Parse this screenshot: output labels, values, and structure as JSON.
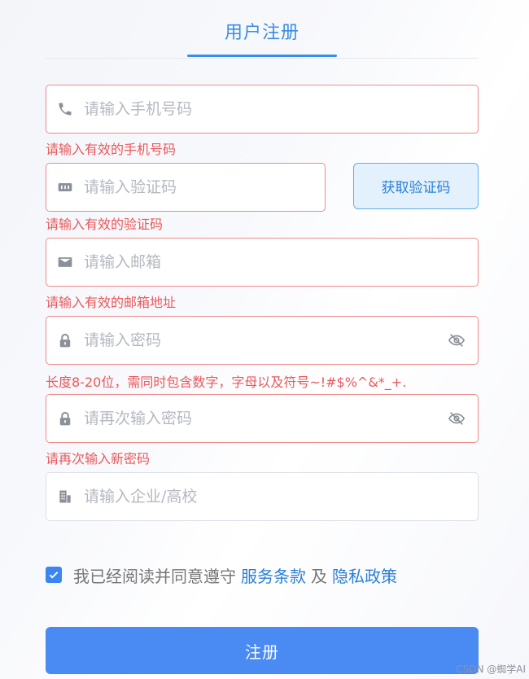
{
  "header": {
    "title": "用户注册"
  },
  "form": {
    "phone": {
      "placeholder": "请输入手机号码",
      "error": "请输入有效的手机号码"
    },
    "code": {
      "placeholder": "请输入验证码",
      "error": "请输入有效的验证码",
      "button_label": "获取验证码"
    },
    "email": {
      "placeholder": "请输入邮箱",
      "error": "请输入有效的邮箱地址"
    },
    "password": {
      "placeholder": "请输入密码",
      "error": "长度8-20位，需同时包含数字，字母以及符号~!#$%^&*_+."
    },
    "confirm": {
      "placeholder": "请再次输入密码",
      "error": "请再次输入新密码"
    },
    "company": {
      "placeholder": "请输入企业/高校"
    }
  },
  "agreement": {
    "checked": true,
    "prefix": "我已经阅读并同意遵守",
    "terms_link": "服务条款",
    "and": "及",
    "privacy_link": "隐私政策"
  },
  "submit_label": "注册",
  "watermark": "CSDN @蜘学AI",
  "colors": {
    "primary": "#4a8af3",
    "accent": "#3a8ee6",
    "error": "#e9595b",
    "error_border": "#f08a8a"
  }
}
